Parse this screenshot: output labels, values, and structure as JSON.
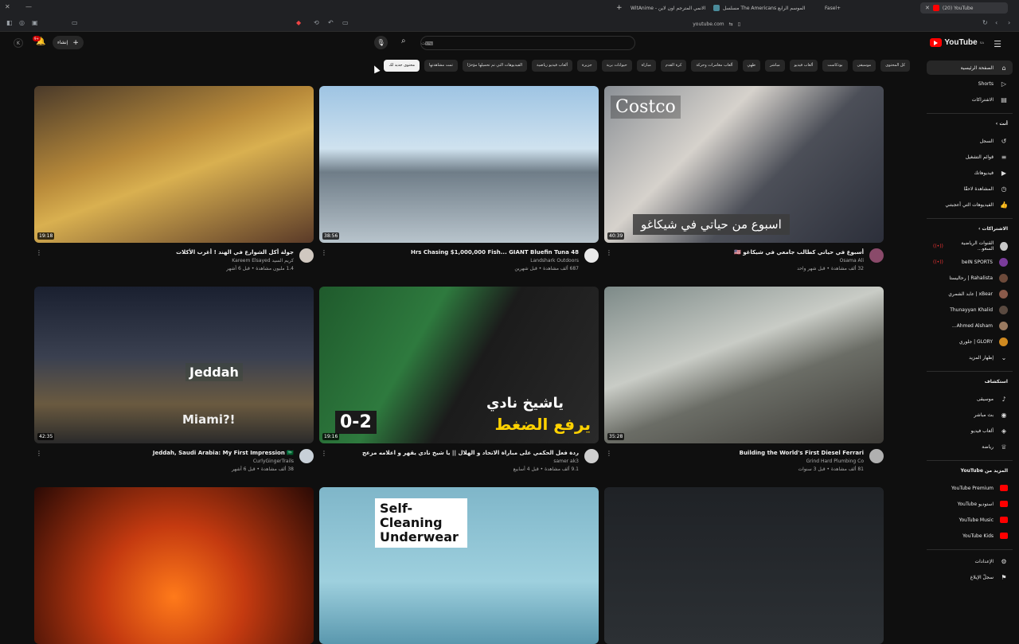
{
  "browser": {
    "tabs": [
      {
        "label": "Fasel+"
      },
      {
        "label": "مسلسل The Americans الموسم الرابع"
      },
      {
        "label": "WitAnime - مشاهدة الانمي المترجم اون لاين"
      },
      {
        "label": "(20) YouTube"
      }
    ],
    "url": "youtube.com"
  },
  "header": {
    "logo_text": "YouTube",
    "logo_region": "SA",
    "search_placeholder": "بحث",
    "create_label": "إنشاء",
    "notif_count": "9+"
  },
  "chips": [
    {
      "label": "كل المحتوى",
      "selected": false
    },
    {
      "label": "موسيقى",
      "selected": false
    },
    {
      "label": "بودكاست",
      "selected": false
    },
    {
      "label": "ألعاب فيديو",
      "selected": false
    },
    {
      "label": "مباشر",
      "selected": false
    },
    {
      "label": "طهي",
      "selected": false
    },
    {
      "label": "ألعاب مغامرات وحركة",
      "selected": false
    },
    {
      "label": "كرة القدم",
      "selected": false
    },
    {
      "label": "مباراة",
      "selected": false
    },
    {
      "label": "حيوانات برية",
      "selected": false
    },
    {
      "label": "جزيرة",
      "selected": false
    },
    {
      "label": "ألعاب فيديو رياضية",
      "selected": false
    },
    {
      "label": "الفيديوهات التي تم تحميلها مؤخرًا",
      "selected": false
    },
    {
      "label": "تمت مشاهدتها",
      "selected": false
    },
    {
      "label": "محتوى جديد لك",
      "selected": true
    }
  ],
  "videos": [
    {
      "title": "أسبوع في حياتي كطالب جامعي في شيكاغو 🇺🇸",
      "channel": "Osama Ali",
      "stats": "32 ألف مشاهدة • قبل شهر واحد",
      "duration": "40:39",
      "thumb_text": "اسبوع من حياتي  في شيكاغو",
      "thumb_brand": "Costco"
    },
    {
      "title": "48 Hrs Chasing $1,000,000 Fish... GIANT Bluefin Tuna",
      "channel": "Landshark Outdoors",
      "stats": "687 ألف مشاهدة • قبل شهرين",
      "duration": "38:56"
    },
    {
      "title": "جولة أكل الشوارع في الهند ! أغرب الأكلات",
      "channel": "كريم السيد Kareem Elsayed",
      "stats": "1.4 مليون مشاهدة • قبل 6 أشهر",
      "duration": "19:18"
    },
    {
      "title": "Building the World's First Diesel Ferrari",
      "channel": "Grind Hard Plumbing Co",
      "stats": "81 ألف مشاهدة • قبل 3 سنوات",
      "duration": "35:28"
    },
    {
      "title": "ردة فعل الحكمي على مباراة الاتحاد و الهلال || يا شيخ نادي يقهر و اعلامه مزعج",
      "channel": "samer ak3",
      "stats": "9.1 ألف مشاهدة • قبل 4 أسابيع",
      "duration": "19:16",
      "thumb_text": "يرفع الضغط",
      "thumb_text2": "ياشيخ نادي",
      "score": "0-2"
    },
    {
      "title": "Jeddah, Saudi Arabia: My First Impression 🇸🇦",
      "channel": "CurlyGingerTrails",
      "stats": "38 ألف مشاهدة • قبل 6 أشهر",
      "duration": "42:35",
      "thumb_text": "Jeddah",
      "thumb_text2": "Miami?!"
    },
    {
      "title": "",
      "channel": "",
      "stats": "",
      "duration": ""
    },
    {
      "title": "",
      "channel": "",
      "stats": "",
      "duration": "",
      "thumb_text": "Self-Cleaning Underwear"
    },
    {
      "title": "",
      "channel": "",
      "stats": "",
      "duration": ""
    }
  ],
  "sidebar": {
    "main": [
      {
        "label": "الصفحة الرئيسية",
        "icon": "home-icon"
      },
      {
        "label": "Shorts",
        "icon": "shorts-icon"
      },
      {
        "label": "الاشتراكات",
        "icon": "subscriptions-icon"
      }
    ],
    "you_header": "أنت",
    "you": [
      {
        "label": "السجل",
        "icon": "history-icon"
      },
      {
        "label": "قوائم التشغيل",
        "icon": "playlists-icon"
      },
      {
        "label": "فيديوهاتك",
        "icon": "your-videos-icon"
      },
      {
        "label": "المشاهدة لاحقًا",
        "icon": "watch-later-icon"
      },
      {
        "label": "الفيديوهات التي أعجبتني",
        "icon": "liked-icon"
      }
    ],
    "subs_header": "الاشتراكات",
    "subs": [
      {
        "label": "القنوات الرياضية السعو...",
        "live": true,
        "color": "#c8c8c8"
      },
      {
        "label": "beIN SPORTS",
        "live": true,
        "color": "#7a3b9a"
      },
      {
        "label": "Rahalista | رحاليستا",
        "live": false,
        "color": "#6d4a3a"
      },
      {
        "label": "xBear | عابد الشمري",
        "live": false,
        "color": "#8a5a4a"
      },
      {
        "label": "Thunayyan Khalid",
        "live": false,
        "color": "#5a4a40"
      },
      {
        "label": "Ahmed Alsham...",
        "live": false,
        "color": "#9a7a60"
      },
      {
        "label": "GLORY | جلوري",
        "live": false,
        "color": "#d08a20"
      },
      {
        "label": "إظهار المزيد",
        "live": false,
        "color": ""
      }
    ],
    "explore_header": "استكشاف",
    "explore": [
      {
        "label": "موسيقى",
        "icon": "music-icon"
      },
      {
        "label": "بث مباشر",
        "icon": "live-icon"
      },
      {
        "label": "ألعاب فيديو",
        "icon": "gaming-icon"
      },
      {
        "label": "رياضة",
        "icon": "trophy-icon"
      }
    ],
    "more_header": "المزيد من YouTube",
    "more": [
      {
        "label": "YouTube Premium"
      },
      {
        "label": "استوديو YouTube"
      },
      {
        "label": "YouTube Music"
      },
      {
        "label": "YouTube Kids"
      }
    ],
    "settings": "الإعدادات",
    "report": "سجلّ الإبلاغ"
  },
  "colors": {
    "accent": "#ff0000",
    "bg": "#0f0f0f"
  }
}
